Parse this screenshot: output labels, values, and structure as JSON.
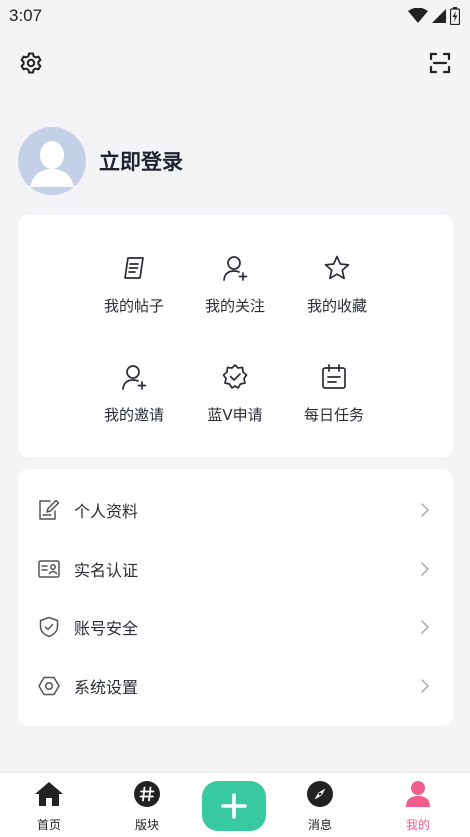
{
  "status_bar": {
    "time": "3:07",
    "icons": [
      "wifi-icon",
      "signal-icon",
      "battery-icon"
    ]
  },
  "top_bar": {
    "left_icon": "gear-icon",
    "right_icon": "scan-icon"
  },
  "profile": {
    "login_label": "立即登录",
    "avatar_icon": "default-avatar-icon"
  },
  "quick_grid": [
    {
      "label": "我的帖子",
      "icon": "posts-icon"
    },
    {
      "label": "我的关注",
      "icon": "follow-user-icon"
    },
    {
      "label": "我的收藏",
      "icon": "star-icon"
    },
    {
      "label": "我的邀请",
      "icon": "invite-user-icon"
    },
    {
      "label": "蓝V申请",
      "icon": "verified-badge-icon"
    },
    {
      "label": "每日任务",
      "icon": "calendar-icon"
    }
  ],
  "menu_list": [
    {
      "label": "个人资料",
      "icon": "edit-profile-icon"
    },
    {
      "label": "实名认证",
      "icon": "id-card-icon"
    },
    {
      "label": "账号安全",
      "icon": "shield-check-icon"
    },
    {
      "label": "系统设置",
      "icon": "hex-settings-icon"
    }
  ],
  "tab_bar": {
    "tabs": [
      {
        "label": "首页",
        "icon": "home-icon"
      },
      {
        "label": "版块",
        "icon": "hashtag-icon"
      },
      {
        "label": "消息",
        "icon": "compass-icon"
      },
      {
        "label": "我的",
        "icon": "person-icon"
      }
    ],
    "active": "我的",
    "center_icon": "plus-icon"
  },
  "colors": {
    "accent_green": "#39c9a0",
    "active_tab": "#f05c8c",
    "background": "#f4f4f6",
    "avatar_bg": "#c4d0e8"
  }
}
